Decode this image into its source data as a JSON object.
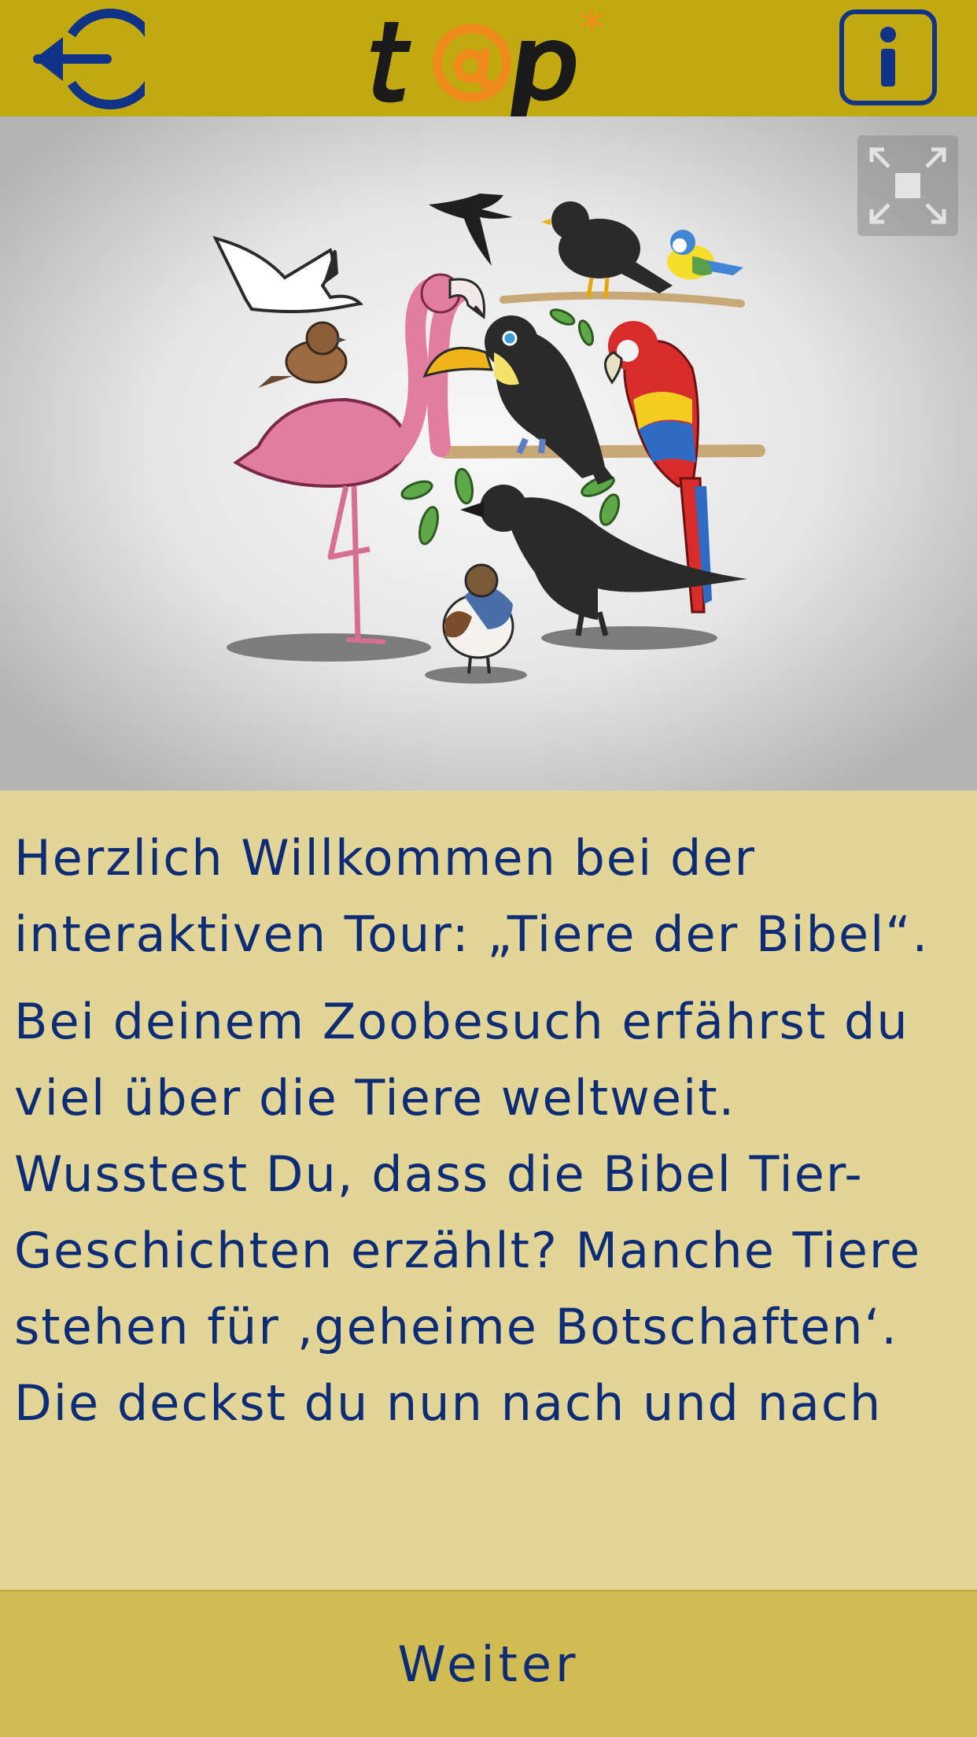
{
  "header": {
    "logo_text": "t@p*",
    "back_button_label": "Back",
    "info_button_label": "Info"
  },
  "hero": {
    "illustration": "birds-illustration",
    "fullscreen_icon": "fullscreen-icon"
  },
  "content": {
    "paragraph1": "Herzlich Willkommen bei der interaktiven Tour: „Tiere der Bibel“.",
    "paragraph2": "Bei deinem Zoobesuch erfährst du viel über die Tiere weltweit. Wusstest Du, dass die Bibel Tier-Geschichten erzählt? Manche Tiere stehen für ‚geheime Botschaften‘. Die deckst du nun nach und nach"
  },
  "footer": {
    "next_label": "Weiter"
  },
  "colors": {
    "header_bg": "#c1a910",
    "content_bg": "#e2d596",
    "footer_bg": "#d1bb52",
    "text": "#0d2c78",
    "logo_orange": "#f08a1c",
    "logo_dark": "#1a1a1a"
  }
}
